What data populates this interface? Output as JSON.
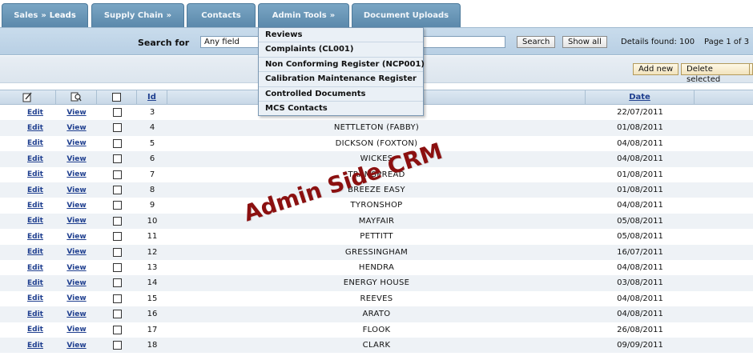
{
  "tabs": [
    {
      "label": "Sales",
      "arrow": "»",
      "sub": "Leads"
    },
    {
      "label": "Supply Chain",
      "arrow": "»"
    },
    {
      "label": "Contacts"
    },
    {
      "label": "Admin Tools",
      "arrow": "»"
    },
    {
      "label": "Document Uploads"
    }
  ],
  "search": {
    "label": "Search for",
    "field": "Any field",
    "button": "Search",
    "show_all": "Show all",
    "details": "Details found: 100",
    "page": "Page 1 of 3"
  },
  "actions": {
    "add_new": "Add new",
    "delete_selected": "Delete selected"
  },
  "dropdown": {
    "items": [
      "Reviews",
      "Complaints (CL001)",
      "Non Conforming Register (NCP001)",
      "Calibration Maintenance Register",
      "Controlled Documents",
      "MCS Contacts"
    ]
  },
  "table": {
    "columns": {
      "id": "Id",
      "date": "Date"
    },
    "edit_label": "Edit",
    "view_label": "View",
    "rows": [
      {
        "id": "3",
        "name": "",
        "date": "22/07/2011"
      },
      {
        "id": "4",
        "name": "NETTLETON (FABBY)",
        "date": "01/08/2011"
      },
      {
        "id": "5",
        "name": "DICKSON (FOXTON)",
        "date": "04/08/2011"
      },
      {
        "id": "6",
        "name": "WICKES",
        "date": "04/08/2011"
      },
      {
        "id": "7",
        "name": "TRAMSPREAD",
        "date": "01/08/2011"
      },
      {
        "id": "8",
        "name": "BREEZE EASY",
        "date": "01/08/2011"
      },
      {
        "id": "9",
        "name": "TYRONSHOP",
        "date": "04/08/2011"
      },
      {
        "id": "10",
        "name": "MAYFAIR",
        "date": "05/08/2011"
      },
      {
        "id": "11",
        "name": "PETTITT",
        "date": "05/08/2011"
      },
      {
        "id": "12",
        "name": "GRESSINGHAM",
        "date": "16/07/2011"
      },
      {
        "id": "13",
        "name": "HENDRA",
        "date": "04/08/2011"
      },
      {
        "id": "14",
        "name": "ENERGY HOUSE",
        "date": "03/08/2011"
      },
      {
        "id": "15",
        "name": "REEVES",
        "date": "04/08/2011"
      },
      {
        "id": "16",
        "name": "ARATO",
        "date": "04/08/2011"
      },
      {
        "id": "17",
        "name": "FLOOK",
        "date": "26/08/2011"
      },
      {
        "id": "18",
        "name": "CLARK",
        "date": "09/09/2011"
      }
    ]
  },
  "watermark": "Admin Side CRM",
  "icons": {
    "edit_header": "pencil-note-icon",
    "view_header": "magnifier-icon",
    "select_all": "checkbox-icon"
  }
}
